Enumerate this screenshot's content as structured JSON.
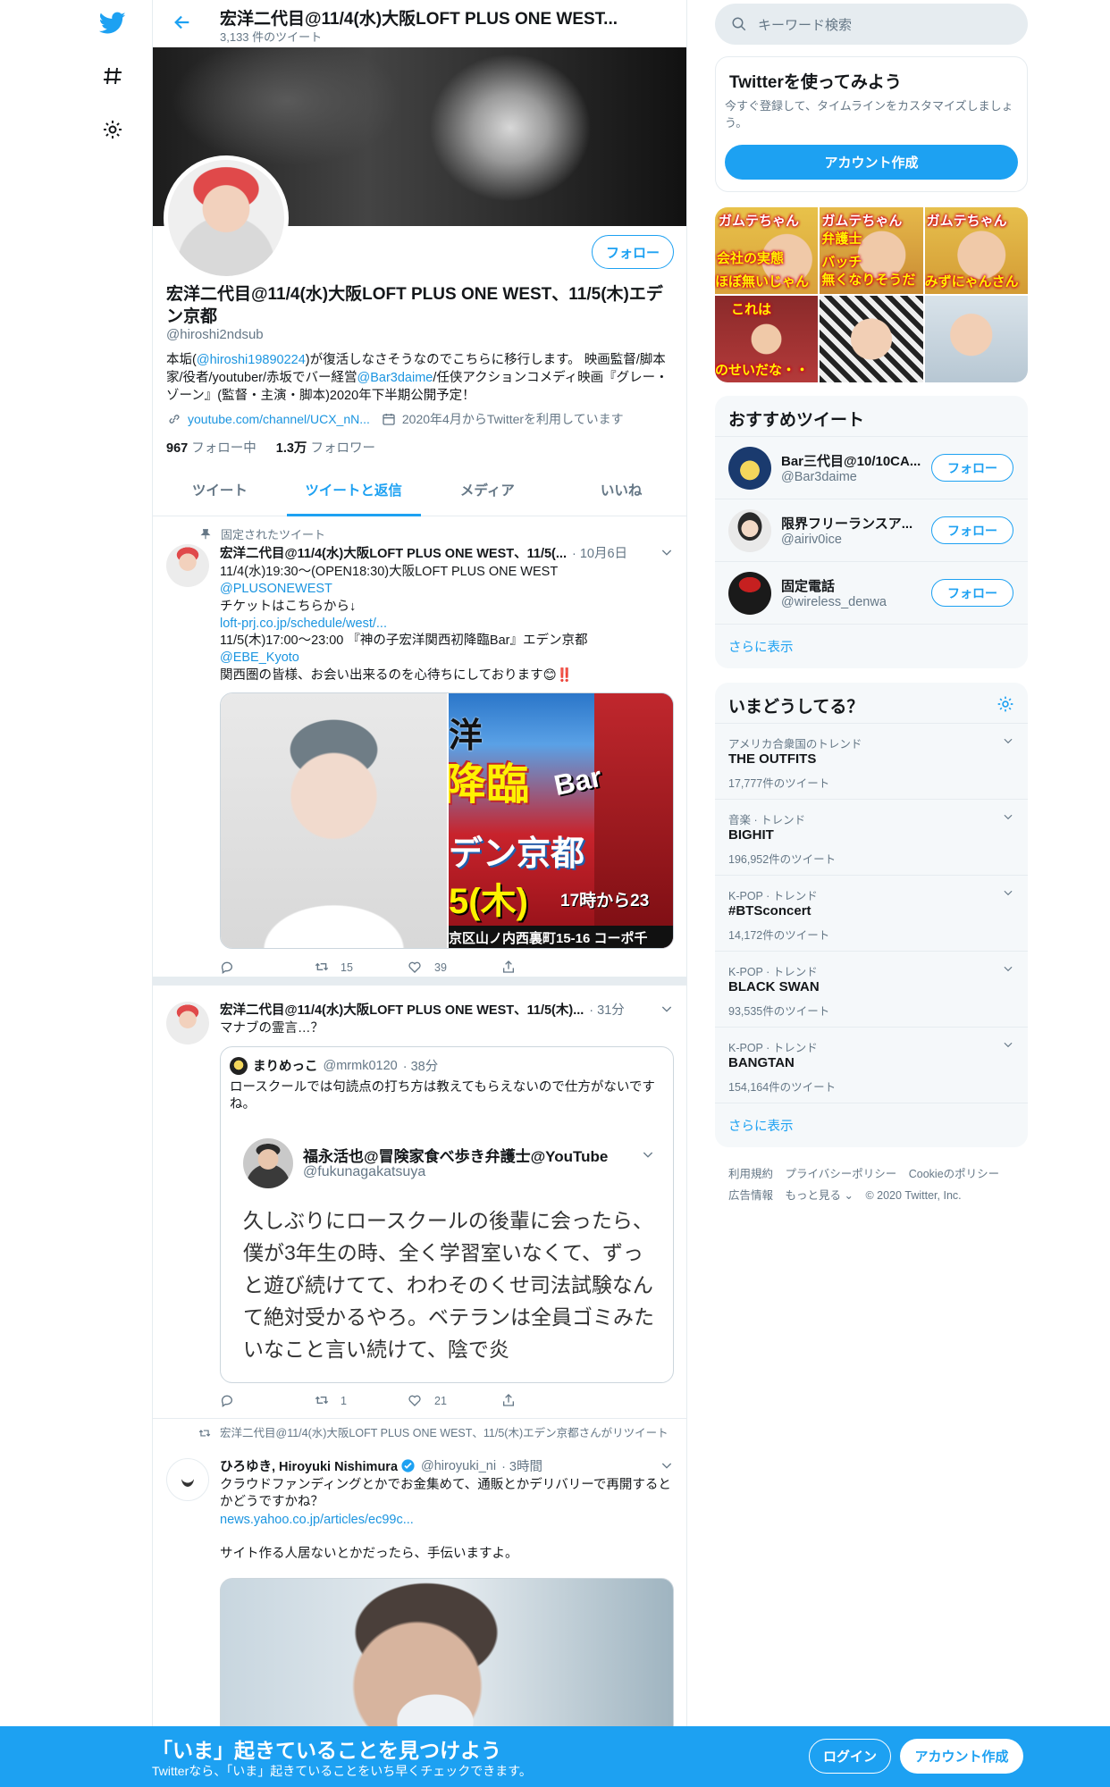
{
  "colors": {
    "accent": "#1da1f2",
    "text": "#14171a",
    "muted": "#657786",
    "border": "#e6ecf0"
  },
  "header": {
    "title": "宏洋二代目@11/4(水)大阪LOFT PLUS ONE WEST...",
    "tweet_count": "3,133 件のツイート"
  },
  "profile": {
    "follow_label": "フォロー",
    "name": "宏洋二代目@11/4(水)大阪LOFT PLUS ONE WEST、11/5(木)エデン京都",
    "handle": "@hiroshi2ndsub",
    "bio_1": "本垢(",
    "bio_mention_1": "@hiroshi19890224",
    "bio_2": ")が復活しなさそうなのでこちらに移行します。 映画監督/脚本家/役者/youtuber/赤坂でバー経営",
    "bio_mention_2": "@Bar3daime",
    "bio_3": "/任侠アクションコメディ映画『グレー・ゾーン』(監督・主演・脚本)2020年下半期公開予定！",
    "link": "youtube.com/channel/UCX_nN...",
    "joined": "2020年4月からTwitterを利用しています",
    "following_count": "967",
    "following_label": "フォロー中",
    "followers_count": "1.3万",
    "followers_label": "フォロワー"
  },
  "tabs": [
    {
      "label": "ツイート"
    },
    {
      "label": "ツイートと返信"
    },
    {
      "label": "メディア"
    },
    {
      "label": "いいね"
    }
  ],
  "tweets": {
    "pinned": {
      "pinned_label": "固定されたツイート",
      "name": "宏洋二代目@11/4(水)大阪LOFT PLUS ONE WEST、11/5(...",
      "time": "· 10月6日",
      "line1": "11/4(水)19:30〜(OPEN18:30)大阪LOFT PLUS ONE WEST",
      "mention1": "@PLUSONEWEST",
      "line2": "チケットはこちらから↓",
      "link1": "loft-prj.co.jp/schedule/west/...",
      "line3": "11/5(木)17:00〜23:00 『神の子宏洋関西初降臨Bar』エデン京都",
      "mention2": "@EBE_Kyoto",
      "line4": "関西圏の皆様、お会い出来るのを心待ちにしております😊‼️",
      "poster_top": "洋",
      "poster_kanji": "降臨",
      "poster_bar": "Bar",
      "poster_place": "デン京都",
      "poster_date": "5(木)",
      "poster_time": "17時から23",
      "poster_addr": "京区山ノ内西裏町15-16 コーポ千",
      "retweets": "15",
      "likes": "39"
    },
    "second": {
      "name": "宏洋二代目@11/4(水)大阪LOFT PLUS ONE WEST、11/5(木)...",
      "time": "· 31分",
      "text": "マナブの霊言…？",
      "quote_name": "まりめっこ",
      "quote_handle": "@mrmk0120",
      "quote_time": "· 38分",
      "quote_text": "ロースクールでは句読点の打ち方は教えてもらえないので仕方がないですね。",
      "inner_name": "福永活也@冒険家食べ歩き弁護士@YouTube",
      "inner_handle": "@fukunagakatsuya",
      "inner_text": "久しぶりにロースクールの後輩に会ったら、僕が3年生の時、全く学習室いなくて、ずっと遊び続けてて、わわそのくせ司法試験なんて絶対受かるやろ。ベテランは全員ゴミみたいなこと言い続けて、陰で炎",
      "retweets": "1",
      "likes": "21"
    },
    "third": {
      "rt_label": "宏洋二代目@11/4(水)大阪LOFT PLUS ONE WEST、11/5(木)エデン京都さんがリツイート",
      "name": "ひろゆき, Hiroyuki Nishimura",
      "handle": "@hiroyuki_ni",
      "time": "· 3時間",
      "text1": "クラウドファンディングとかでお金集めて、通販とかデリバリーで再開するとかどうですかね？",
      "link": "news.yahoo.co.jp/articles/ec99c...",
      "text2": "サイト作る人居ないとかだったら、手伝いますよ。"
    }
  },
  "sidebar": {
    "search_placeholder": "キーワード検索",
    "signup_title": "Twitterを使ってみよう",
    "signup_text": "今すぐ登録して、タイムラインをカスタマイズしましょう。",
    "signup_button": "アカウント作成",
    "thumbs": [
      {
        "cap1": "ガムテちゃん",
        "cap2": "会社の実態",
        "cap3": "ほぼ無いじゃん"
      },
      {
        "cap1": "ガムテちゃん",
        "cap2": "弁護士",
        "cap3": "バッチ",
        "cap4": "無くなりそうだ"
      },
      {
        "cap1": "ガムテちゃん",
        "cap2": "",
        "cap3": "みずにゃんさん"
      },
      {
        "cap1": "これは",
        "cap2": "のせいだな・・"
      },
      {
        "cap1": ""
      },
      {
        "cap1": ""
      }
    ],
    "recommend_title": "おすすめツイート",
    "recommend": [
      {
        "name": "Bar三代目@10/10CA...",
        "handle": "@Bar3daime",
        "button": "フォロー"
      },
      {
        "name": "限界フリーランスア...",
        "handle": "@airiv0ice",
        "button": "フォロー"
      },
      {
        "name": "固定電話",
        "handle": "@wireless_denwa",
        "button": "フォロー"
      }
    ],
    "show_more": "さらに表示",
    "trends_title": "いまどうしてる？",
    "trends": [
      {
        "context": "アメリカ合衆国のトレンド",
        "name": "THE OUTFITS",
        "count": "17,777件のツイート"
      },
      {
        "context": "音楽 · トレンド",
        "name": "BIGHIT",
        "count": "196,952件のツイート"
      },
      {
        "context": "K-POP · トレンド",
        "name": "#BTSconcert",
        "count": "14,172件のツイート"
      },
      {
        "context": "K-POP · トレンド",
        "name": "BLACK SWAN",
        "count": "93,535件のツイート"
      },
      {
        "context": "K-POP · トレンド",
        "name": "BANGTAN",
        "count": "154,164件のツイート"
      }
    ],
    "trends_more": "さらに表示",
    "footer": {
      "terms": "利用規約",
      "privacy": "プライバシーポリシー",
      "cookie": "Cookieのポリシー",
      "ads": "広告情報",
      "more": "もっと見る ⌄",
      "copyright": "© 2020 Twitter, Inc."
    }
  },
  "bottom": {
    "title": "「いま」起きていることを見つけよう",
    "subtitle": "Twitterなら、「いま」起きていることをいち早くチェックできます。",
    "login": "ログイン",
    "signup": "アカウント作成"
  }
}
